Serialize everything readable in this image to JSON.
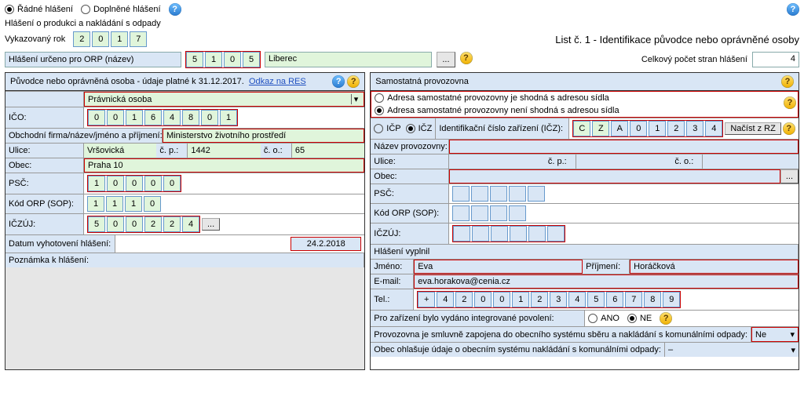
{
  "top": {
    "ordinary": "Řádné hlášení",
    "amended": "Doplněné hlášení",
    "title": "Hlášení o produkci a nakládání s odpady",
    "year_label": "Vykazovaný rok",
    "year": [
      "2",
      "0",
      "1",
      "7"
    ],
    "sheet": "List č. 1 - Identifikace původce nebo oprávněné osoby",
    "orp_label": "Hlášení určeno pro ORP (název)",
    "orp_code": [
      "5",
      "1",
      "0",
      "5"
    ],
    "orp_name": "Liberec",
    "dots": "...",
    "pages_label": "Celkový počet stran hlášení",
    "pages": "4"
  },
  "left": {
    "head": "Původce nebo oprávněná osoba - údaje platné k 31.12.2017.",
    "res": "Odkaz na RES",
    "type": "Právnická osoba",
    "ico_l": "IČO:",
    "ico": [
      "0",
      "0",
      "1",
      "6",
      "4",
      "8",
      "0",
      "1"
    ],
    "name_l": "Obchodní firma/název/jméno a příjmení:",
    "name": "Ministerstvo životního prostředí",
    "ul_l": "Ulice:",
    "ul": "Vršovická",
    "cp_l": "č. p.:",
    "cp": "1442",
    "co_l": "č. o.:",
    "co": "65",
    "obec_l": "Obec:",
    "obec": "Praha 10",
    "psc_l": "PSČ:",
    "psc": [
      "1",
      "0",
      "0",
      "0",
      "0"
    ],
    "sop_l": "Kód ORP (SOP):",
    "sop": [
      "1",
      "1",
      "1",
      "0"
    ],
    "iczuj_l": "IČZÚJ:",
    "iczuj": [
      "5",
      "0",
      "0",
      "2",
      "2",
      "4"
    ],
    "date_l": "Datum vyhotovení hlášení:",
    "date": "24.2.2018",
    "note_l": "Poznámka k hlášení:"
  },
  "right": {
    "head": "Samostatná provozovna",
    "opt1": "Adresa samostatné provozovny je shodná s adresou sídla",
    "opt2": "Adresa samostatné provozovny není shodná s adresou sídla",
    "icp": "IČP",
    "icz": "IČZ",
    "icz_l": "Identifikační číslo zařízení (IČZ):",
    "icz_v": [
      "C",
      "Z",
      "A",
      "0",
      "1",
      "2",
      "3",
      "4"
    ],
    "rz": "Načíst z RZ",
    "nazev_l": "Název provozovny:",
    "ul_l": "Ulice:",
    "cp_l": "č. p.:",
    "co_l": "č. o.:",
    "obec_l": "Obec:",
    "dots": "...",
    "psc_l": "PSČ:",
    "psc": [
      "",
      "",
      "",
      "",
      ""
    ],
    "sop_l": "Kód ORP (SOP):",
    "sop": [
      "",
      "",
      "",
      ""
    ],
    "iczuj_l": "IČZÚJ:",
    "iczuj": [
      "",
      "",
      "",
      "",
      "",
      ""
    ],
    "filled": "Hlášení vyplnil",
    "jm_l": "Jméno:",
    "jm": "Eva",
    "pr_l": "Příjmení:",
    "pr": "Horáčková",
    "em_l": "E-mail:",
    "em": "eva.horakova@cenia.cz",
    "tel_l": "Tel.:",
    "tel": [
      "+",
      "4",
      "2",
      "0",
      "0",
      "1",
      "2",
      "3",
      "4",
      "5",
      "6",
      "7",
      "8",
      "9"
    ],
    "ip_l": "Pro zařízení bylo vydáno integrované povolení:",
    "ano": "ANO",
    "ne": "NE",
    "sml_l": "Provozovna je smluvně zapojena do obecního systému sběru a nakládání s komunálními odpady:",
    "sml_v": "Ne",
    "ob_l": "Obec ohlašuje údaje o obecním systému nakládání s komunálními odpady:",
    "ob_v": "–"
  }
}
